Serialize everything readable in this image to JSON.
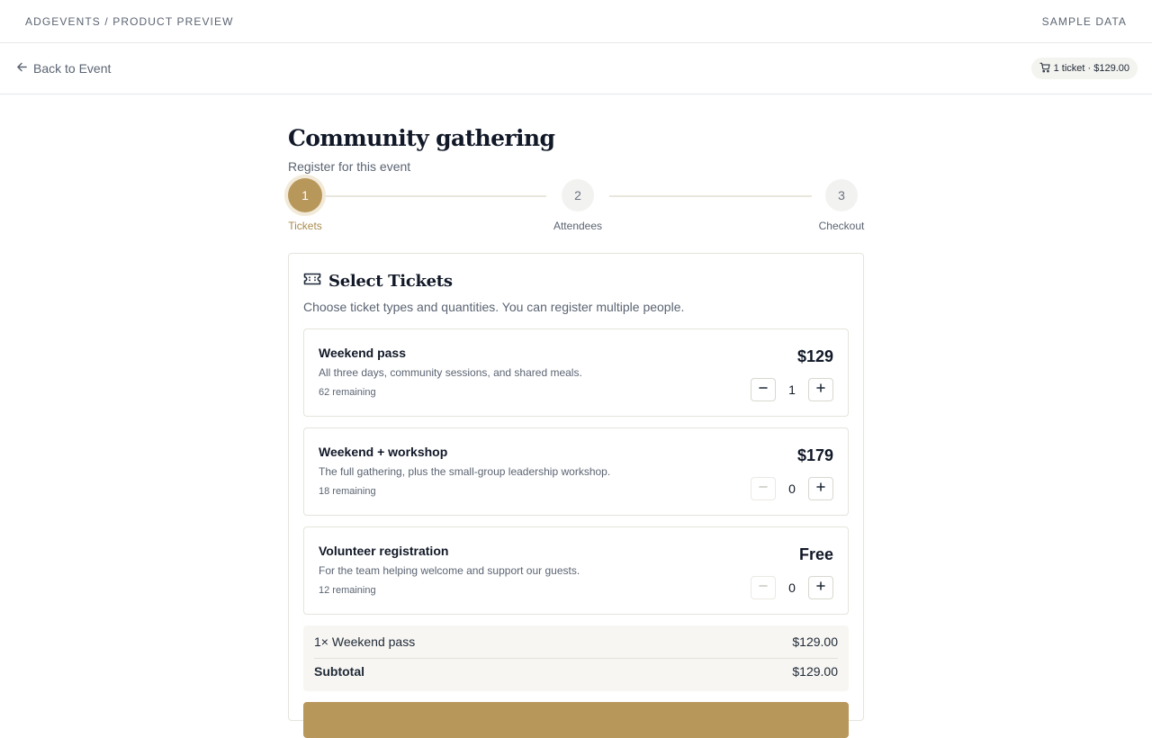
{
  "topbar": {
    "brand": "ADGEVENTS / PRODUCT PREVIEW",
    "sample_label": "SAMPLE DATA"
  },
  "nav": {
    "back_label": "Back to Event",
    "cart_summary": "1 ticket · $129.00"
  },
  "event": {
    "title": "Community gathering",
    "subtitle": "Register for this event"
  },
  "steps": [
    {
      "number": "1",
      "label": "Tickets",
      "active": true
    },
    {
      "number": "2",
      "label": "Attendees",
      "active": false
    },
    {
      "number": "3",
      "label": "Checkout",
      "active": false
    }
  ],
  "card": {
    "title": "Select Tickets",
    "description": "Choose ticket types and quantities. You can register multiple people.",
    "icon": "ticket-icon"
  },
  "tickets": [
    {
      "name": "Weekend pass",
      "description": "All three days, community sessions, and shared meals.",
      "remaining": "62 remaining",
      "price": "$129",
      "quantity": "1"
    },
    {
      "name": "Weekend + workshop",
      "description": "The full gathering, plus the small-group leadership workshop.",
      "remaining": "18 remaining",
      "price": "$179",
      "quantity": "0"
    },
    {
      "name": "Volunteer registration",
      "description": "For the team helping welcome and support our guests.",
      "remaining": "12 remaining",
      "price": "Free",
      "quantity": "0"
    }
  ],
  "summary": {
    "line_label": "1× Weekend pass",
    "line_amount": "$129.00",
    "subtotal_label": "Subtotal",
    "subtotal_amount": "$129.00"
  },
  "colors": {
    "accent": "#b8975b",
    "accent_ring": "#f2ead8",
    "muted_text": "#5b6472"
  }
}
